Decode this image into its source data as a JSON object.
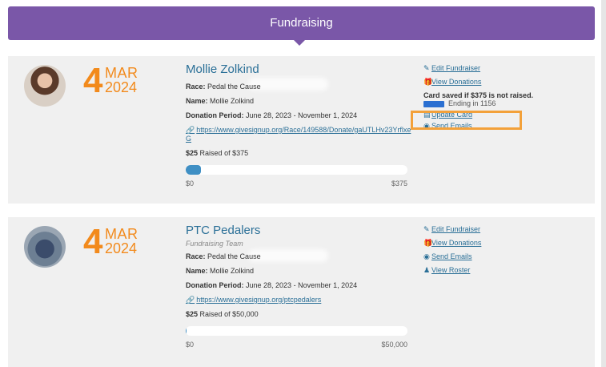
{
  "header": {
    "title": "Fundraising"
  },
  "fundraisers": [
    {
      "date": {
        "day": "4",
        "month": "MAR",
        "year": "2024"
      },
      "name": "Mollie Zolkind",
      "subtype": "",
      "race_label": "Race:",
      "race": "Pedal the Cause",
      "name_label": "Name:",
      "person": "Mollie Zolkind",
      "period_label": "Donation Period:",
      "period": "June 28, 2023 - November 1, 2024",
      "url": "https://www.givesignup.org/Race/149588/Donate/gaUTLHv23YrflxeG",
      "raised_amount": "$25",
      "raised_text": "Raised of $375",
      "progress_pct": 6.7,
      "range_min": "$0",
      "range_max": "$375",
      "actions": {
        "edit": "Edit Fundraiser",
        "view_donations": "View Donations",
        "card_note": "Card saved if $375 is not raised.",
        "card_ending": "Ending in 1156",
        "update_card": "Update Card",
        "send_emails": "Send Emails"
      }
    },
    {
      "date": {
        "day": "4",
        "month": "MAR",
        "year": "2024"
      },
      "name": "PTC Pedalers",
      "subtype": "Fundraising Team",
      "race_label": "Race:",
      "race": "Pedal the Cause",
      "name_label": "Name:",
      "person": "Mollie Zolkind",
      "period_label": "Donation Period:",
      "period": "June 28, 2023 - November 1, 2024",
      "url": "https://www.givesignup.org/ptcpedalers",
      "raised_amount": "$25",
      "raised_text": "Raised of $50,000",
      "progress_pct": 0.05,
      "range_min": "$0",
      "range_max": "$50,000",
      "actions": {
        "edit": "Edit Fundraiser",
        "view_donations": "View Donations",
        "send_emails": "Send Emails",
        "view_roster": "View Roster"
      }
    }
  ],
  "colors": {
    "header": "#7a57a8",
    "accent": "#f28a1c",
    "link": "#2a6f97",
    "highlight": "#f3a13a",
    "progress": "#3f8fc4"
  }
}
